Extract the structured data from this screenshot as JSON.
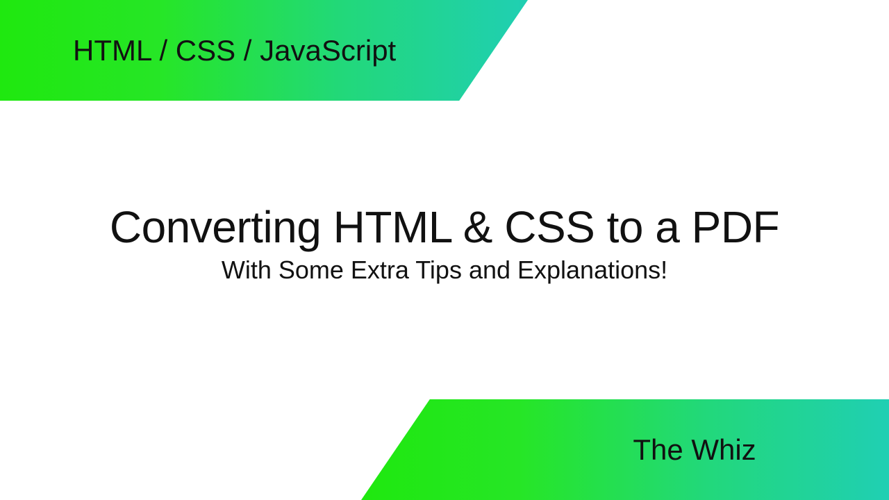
{
  "header": {
    "category": "HTML / CSS / JavaScript"
  },
  "main": {
    "title": "Converting HTML & CSS to a PDF",
    "subtitle": "With Some Extra Tips and Explanations!"
  },
  "footer": {
    "author": "The Whiz"
  }
}
